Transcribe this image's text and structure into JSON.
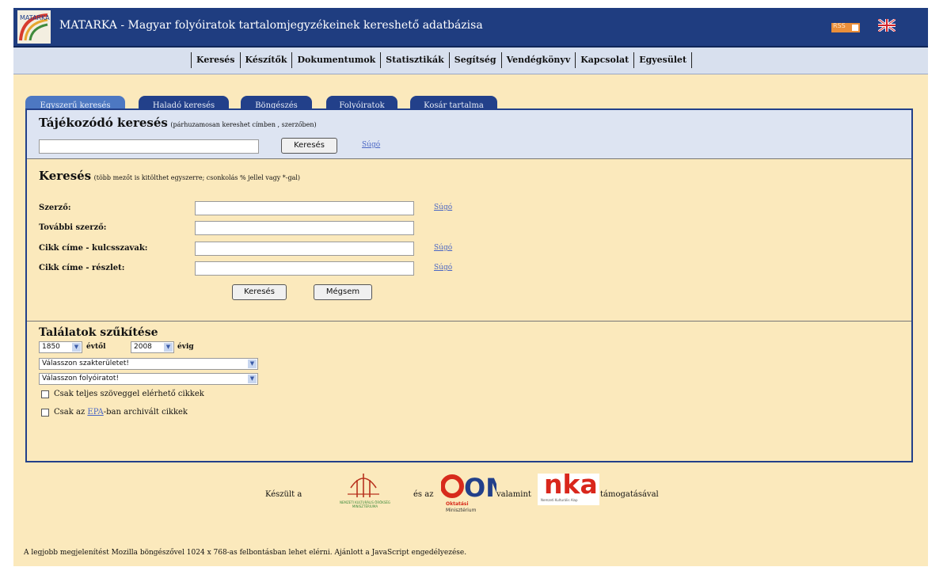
{
  "header": {
    "title": "MATARKA - Magyar folyóiratok tartalomjegyzékeinek kereshető adatbázisa",
    "logo_text": "MATARKA",
    "rss_label": "RSS",
    "language_flag": "uk-flag-icon"
  },
  "nav": {
    "items": [
      "Keresés",
      "Készítők",
      "Dokumentumok",
      "Statisztikák",
      "Segítség",
      "Vendégkönyv",
      "Kapcsolat",
      "Egyesület"
    ]
  },
  "tabs": [
    "Egyszerű keresés",
    "Haladó keresés",
    "Böngészés",
    "Folyóiratok",
    "Kosár tartalma"
  ],
  "quick_search": {
    "title": "Tájékozódó keresés",
    "subtitle": "(párhuzamosan kereshet címben , szerzőben)",
    "value": "",
    "button": "Keresés",
    "help": "Súgó"
  },
  "search": {
    "title": "Keresés",
    "subtitle": "(több mezőt is kitölthet egyszerre; csonkolás % jellel vagy *-gal)",
    "fields": [
      {
        "label": "Szerző:",
        "value": "",
        "help": "Súgó"
      },
      {
        "label": "További szerző:",
        "value": "",
        "help": ""
      },
      {
        "label": "Cikk címe - kulcsszavak:",
        "value": "",
        "help": "Súgó"
      },
      {
        "label": "Cikk címe - részlet:",
        "value": "",
        "help": "Súgó"
      }
    ],
    "search_button": "Keresés",
    "cancel_button": "Mégsem"
  },
  "filter": {
    "title": "Találatok szűkítése",
    "from_year": "1850",
    "from_suffix": "évtől",
    "to_year": "2008",
    "to_suffix": "évig",
    "community_select": "Válasszon szakterületet!",
    "journal_select": "Válasszon folyóiratot!",
    "fulltext_label": "Csak teljes szöveggel elérhető cikkek",
    "epa_prefix": "Csak az ",
    "epa_link": "EPA",
    "epa_suffix": "-ban archivált cikkek"
  },
  "sponsors": {
    "made_by": "Készült a",
    "and": "és az",
    "also": "valamint",
    "support": "támogatásával",
    "nkom_caption": "NEMZETI KULTURÁLIS ÖRÖKSÉG MINISZTÉRIUMA",
    "om_logo": "OM",
    "om_caption_1": "Oktatási",
    "om_caption_2": "Minisztérium",
    "nka_logo": "nka",
    "nka_caption": "Nemzeti Kulturális Alap"
  },
  "footer": {
    "note": "A legjobb megjelenítést Mozilla böngészővel 1024 x 768-as felbontásban lehet elérni. Ajánlott a JavaScript engedélyezése."
  },
  "colors": {
    "header_bg": "#1f3d80",
    "page_bg": "#fbe9bc",
    "tab_bg": "#22408a",
    "tab_active_bg": "#4d78c2",
    "quick_bg": "#dde4f2",
    "link": "#4a66c4",
    "om_red": "#d72a1b",
    "nka_red": "#d9261c"
  }
}
